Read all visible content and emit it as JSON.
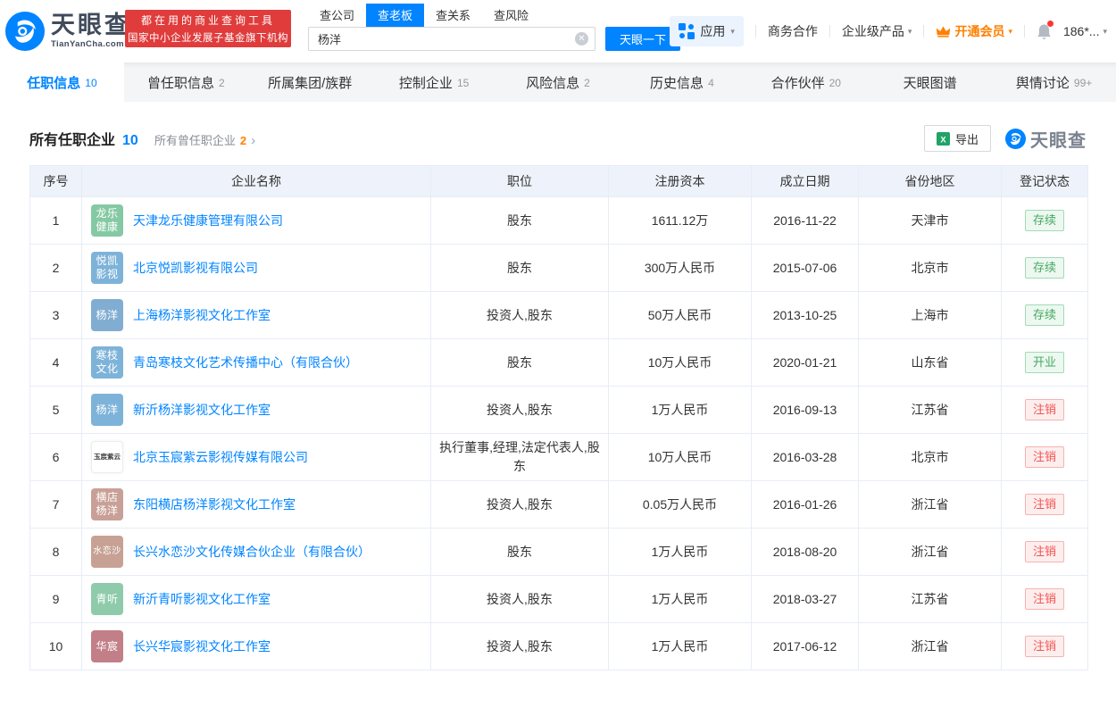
{
  "colors": {
    "accent": "#0084ff",
    "vip_orange": "#ff8000",
    "promo_red": "#e03c3c",
    "status_green": "#46a963",
    "status_red": "#f25353"
  },
  "header": {
    "logo": {
      "name": "天眼查",
      "domain": "TianYanCha.com"
    },
    "promo": {
      "line1": "都在用的商业查询工具",
      "line2": "国家中小企业发展子基金旗下机构"
    },
    "search": {
      "tabs": [
        {
          "label": "查公司",
          "active": false
        },
        {
          "label": "查老板",
          "active": true
        },
        {
          "label": "查关系",
          "active": false
        },
        {
          "label": "查风险",
          "active": false
        }
      ],
      "value": "杨洋",
      "button": "天眼一下"
    },
    "nav": {
      "apps": "应用",
      "business": "商务合作",
      "enterprise": "企业级产品",
      "vip": "开通会员",
      "phone": "186*..."
    }
  },
  "tabs": [
    {
      "label": "任职信息",
      "count": "10",
      "active": true
    },
    {
      "label": "曾任职信息",
      "count": "2",
      "active": false
    },
    {
      "label": "所属集团/族群",
      "count": "",
      "active": false
    },
    {
      "label": "控制企业",
      "count": "15",
      "active": false
    },
    {
      "label": "风险信息",
      "count": "2",
      "active": false
    },
    {
      "label": "历史信息",
      "count": "4",
      "active": false
    },
    {
      "label": "合作伙伴",
      "count": "20",
      "active": false
    },
    {
      "label": "天眼图谱",
      "count": "",
      "active": false
    },
    {
      "label": "舆情讨论",
      "count": "99+",
      "active": false
    }
  ],
  "section": {
    "title": "所有任职企业",
    "title_count": "10",
    "subtitle": "所有曾任职企业",
    "subtitle_count": "2",
    "chevron": "›",
    "export_label": "导出",
    "watermark": "天眼查"
  },
  "table": {
    "columns": [
      "序号",
      "企业名称",
      "职位",
      "注册资本",
      "成立日期",
      "省份地区",
      "登记状态"
    ],
    "rows": [
      {
        "no": "1",
        "icon_lines": [
          "龙乐",
          "健康"
        ],
        "icon_color": "#85c9a4",
        "icon_light": false,
        "name": "天津龙乐健康管理有限公司",
        "position": "股东",
        "capital": "1611.12万",
        "date": "2016-11-22",
        "province": "天津市",
        "status": "存续",
        "status_type": "green"
      },
      {
        "no": "2",
        "icon_lines": [
          "悦凯",
          "影视"
        ],
        "icon_color": "#7eb3d9",
        "icon_light": false,
        "name": "北京悦凯影视有限公司",
        "position": "股东",
        "capital": "300万人民币",
        "date": "2015-07-06",
        "province": "北京市",
        "status": "存续",
        "status_type": "green"
      },
      {
        "no": "3",
        "icon_lines": [
          "杨洋"
        ],
        "icon_color": "#82add2",
        "icon_light": false,
        "name": "上海杨洋影视文化工作室",
        "position": "投资人,股东",
        "capital": "50万人民币",
        "date": "2013-10-25",
        "province": "上海市",
        "status": "存续",
        "status_type": "green"
      },
      {
        "no": "4",
        "icon_lines": [
          "寒枝",
          "文化"
        ],
        "icon_color": "#7eb3d9",
        "icon_light": false,
        "name": "青岛寒枝文化艺术传播中心（有限合伙）",
        "position": "股东",
        "capital": "10万人民币",
        "date": "2020-01-21",
        "province": "山东省",
        "status": "开业",
        "status_type": "green"
      },
      {
        "no": "5",
        "icon_lines": [
          "杨洋"
        ],
        "icon_color": "#7eb3d9",
        "icon_light": false,
        "name": "新沂杨洋影视文化工作室",
        "position": "投资人,股东",
        "capital": "1万人民币",
        "date": "2016-09-13",
        "province": "江苏省",
        "status": "注销",
        "status_type": "red"
      },
      {
        "no": "6",
        "icon_lines": [
          "玉宸紫云"
        ],
        "icon_color": "#ffffff",
        "icon_light": true,
        "name": "北京玉宸紫云影视传媒有限公司",
        "position": "执行董事,经理,法定代表人,股东",
        "capital": "10万人民币",
        "date": "2016-03-28",
        "province": "北京市",
        "status": "注销",
        "status_type": "red"
      },
      {
        "no": "7",
        "icon_lines": [
          "横店",
          "杨洋"
        ],
        "icon_color": "#c8a097",
        "icon_light": false,
        "name": "东阳横店杨洋影视文化工作室",
        "position": "投资人,股东",
        "capital": "0.05万人民币",
        "date": "2016-01-26",
        "province": "浙江省",
        "status": "注销",
        "status_type": "red"
      },
      {
        "no": "8",
        "icon_lines": [
          "水恋沙"
        ],
        "icon_color": "#c7a294",
        "icon_light": false,
        "name": "长兴水恋沙文化传媒合伙企业（有限合伙）",
        "position": "股东",
        "capital": "1万人民币",
        "date": "2018-08-20",
        "province": "浙江省",
        "status": "注销",
        "status_type": "red"
      },
      {
        "no": "9",
        "icon_lines": [
          "青听"
        ],
        "icon_color": "#8ecbaa",
        "icon_light": false,
        "name": "新沂青听影视文化工作室",
        "position": "投资人,股东",
        "capital": "1万人民币",
        "date": "2018-03-27",
        "province": "江苏省",
        "status": "注销",
        "status_type": "red"
      },
      {
        "no": "10",
        "icon_lines": [
          "华宸"
        ],
        "icon_color": "#c27f88",
        "icon_light": false,
        "name": "长兴华宸影视文化工作室",
        "position": "投资人,股东",
        "capital": "1万人民币",
        "date": "2017-06-12",
        "province": "浙江省",
        "status": "注销",
        "status_type": "red"
      }
    ]
  }
}
